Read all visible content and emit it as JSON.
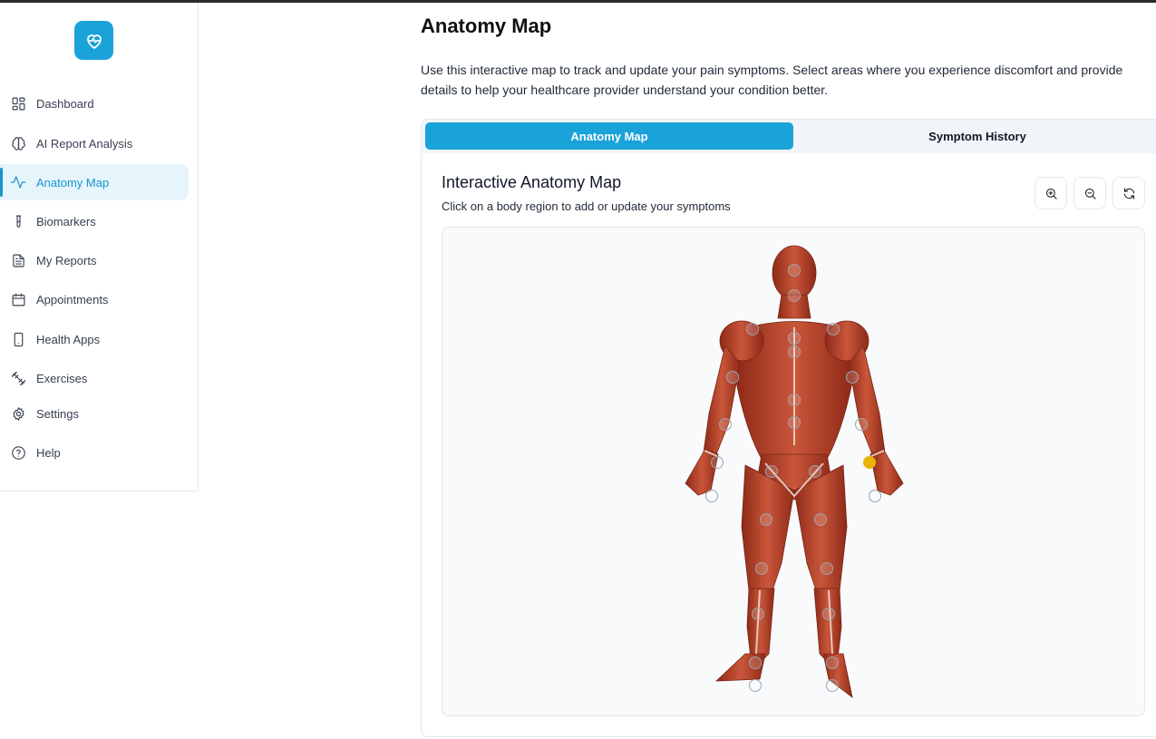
{
  "sidebar": {
    "logo_icon": "heart-pulse-icon",
    "items": [
      {
        "label": "Dashboard",
        "icon": "dashboard-grid-icon"
      },
      {
        "label": "AI Report Analysis",
        "icon": "brain-icon"
      },
      {
        "label": "Anatomy Map",
        "icon": "activity-icon",
        "active": true
      },
      {
        "label": "Biomarkers",
        "icon": "test-tube-icon"
      },
      {
        "label": "My Reports",
        "icon": "file-text-icon"
      },
      {
        "label": "Appointments",
        "icon": "calendar-icon"
      },
      {
        "label": "Health Apps",
        "icon": "smartphone-icon"
      },
      {
        "label": "Exercises",
        "icon": "dumbbell-icon"
      },
      {
        "label": "Settings",
        "icon": "gear-icon"
      },
      {
        "label": "Help",
        "icon": "help-circle-icon"
      }
    ]
  },
  "main": {
    "title": "Anatomy Map",
    "description": "Use this interactive map to track and update your pain symptoms. Select areas where you experience discomfort and provide details to help your healthcare provider understand your condition better.",
    "tabs": [
      {
        "label": "Anatomy Map",
        "active": true
      },
      {
        "label": "Symptom History",
        "active": false
      }
    ],
    "map": {
      "title": "Interactive Anatomy Map",
      "subtitle": "Click on a body region to add or update your symptoms",
      "tools": [
        "zoom-in-icon",
        "zoom-out-icon",
        "reset-icon"
      ],
      "hotspot_count": 34,
      "selected_hotspots": 1
    }
  },
  "colors": {
    "accent": "#1aa3d9",
    "active_nav_bg": "#e6f4fb",
    "selected_hotspot": "#eab308"
  }
}
